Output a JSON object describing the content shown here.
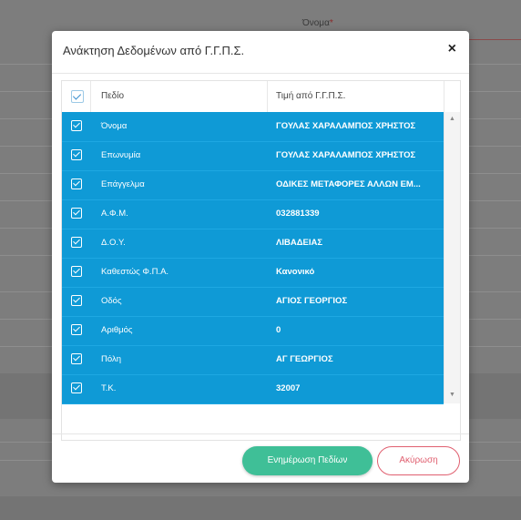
{
  "background": {
    "field_label": "Όνομα",
    "required_mark": "*"
  },
  "modal": {
    "title": "Ανάκτηση Δεδομένων από Γ.Γ.Π.Σ.",
    "close_icon": "close-icon"
  },
  "grid": {
    "columns": {
      "field": "Πεδίο",
      "value": "Τιμή από Γ.Γ.Π.Σ."
    },
    "rows": [
      {
        "field": "Όνομα",
        "value": "ΓΟΥΛΑΣ ΧΑΡΑΛΑΜΠΟΣ ΧΡΗΣΤΟΣ",
        "checked": true
      },
      {
        "field": "Επωνυμία",
        "value": "ΓΟΥΛΑΣ ΧΑΡΑΛΑΜΠΟΣ ΧΡΗΣΤΟΣ",
        "checked": true
      },
      {
        "field": "Επάγγελμα",
        "value": "ΟΔΙΚΕΣ ΜΕΤΑΦΟΡΕΣ ΑΛΛΩΝ ΕΜ...",
        "checked": true
      },
      {
        "field": "Α.Φ.Μ.",
        "value": "032881339",
        "checked": true
      },
      {
        "field": "Δ.Ο.Υ.",
        "value": "ΛΙΒΑΔΕΙΑΣ",
        "checked": true
      },
      {
        "field": "Καθεστώς Φ.Π.Α.",
        "value": "Κανονικό",
        "checked": true
      },
      {
        "field": "Οδός",
        "value": "ΑΓΙΟΣ ΓΕΟΡΓΙΟΣ",
        "checked": true
      },
      {
        "field": "Αριθμός",
        "value": "0",
        "checked": true
      },
      {
        "field": "Πόλη",
        "value": "ΑΓ ΓΕΩΡΓΙΟΣ",
        "checked": true
      },
      {
        "field": "Τ.Κ.",
        "value": "32007",
        "checked": true
      }
    ]
  },
  "footer": {
    "update_label": "Ενημέρωση Πεδίων",
    "cancel_label": "Ακύρωση"
  },
  "colors": {
    "selection": "#0f9ad6",
    "primary": "#3fbf97",
    "danger": "#e06070"
  }
}
